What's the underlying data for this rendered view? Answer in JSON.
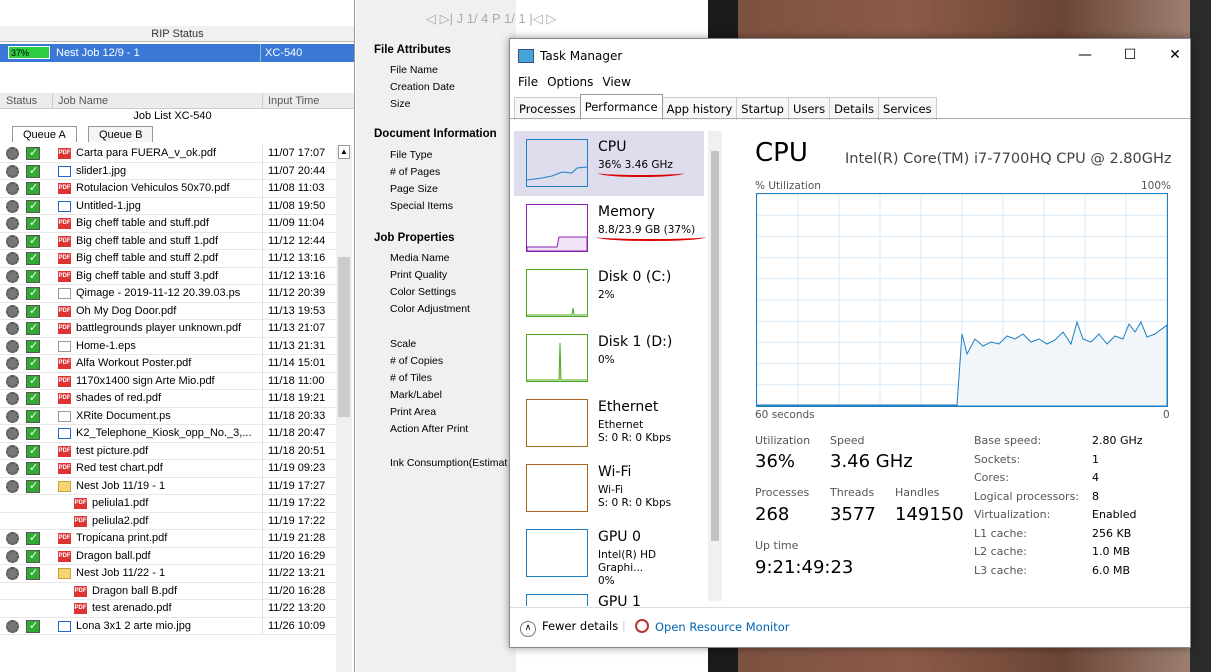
{
  "rip": {
    "title": "RIP Status",
    "progress": "37%",
    "job": "Nest Job 12/9 - 1",
    "printer": "XC-540"
  },
  "joblist": {
    "col_status": "Status",
    "col_job": "Job Name",
    "col_time": "Input Time",
    "title": "Job List XC-540",
    "tab_a": "Queue A",
    "tab_b": "Queue B",
    "rows": [
      {
        "name": "Carta para FUERA_v_ok.pdf",
        "time": "11/07 17:07",
        "type": "pdf"
      },
      {
        "name": "slider1.jpg",
        "time": "11/07 20:44",
        "type": "jpg"
      },
      {
        "name": "Rotulacion Vehiculos 50x70.pdf",
        "time": "11/08 11:03",
        "type": "pdf"
      },
      {
        "name": "Untitled-1.jpg",
        "time": "11/08 19:50",
        "type": "jpg"
      },
      {
        "name": "Big cheff table and stuff.pdf",
        "time": "11/09 11:04",
        "type": "pdf"
      },
      {
        "name": "Big cheff table and stuff 1.pdf",
        "time": "11/12 12:44",
        "type": "pdf"
      },
      {
        "name": "Big cheff table and stuff 2.pdf",
        "time": "11/12 13:16",
        "type": "pdf"
      },
      {
        "name": "Big cheff table and stuff 3.pdf",
        "time": "11/12 13:16",
        "type": "pdf"
      },
      {
        "name": "Qimage - 2019-11-12 20.39.03.ps",
        "time": "11/12 20:39",
        "type": "ps"
      },
      {
        "name": "Oh My Dog Door.pdf",
        "time": "11/13 19:53",
        "type": "pdf"
      },
      {
        "name": "battlegrounds player unknown.pdf",
        "time": "11/13 21:07",
        "type": "pdf"
      },
      {
        "name": "Home-1.eps",
        "time": "11/13 21:31",
        "type": "ps"
      },
      {
        "name": "Alfa Workout  Poster.pdf",
        "time": "11/14 15:01",
        "type": "pdf"
      },
      {
        "name": "1170x1400 sign Arte Mio.pdf",
        "time": "11/18 11:00",
        "type": "pdf"
      },
      {
        "name": "shades of red.pdf",
        "time": "11/18 19:21",
        "type": "pdf"
      },
      {
        "name": "XRite Document.ps",
        "time": "11/18 20:33",
        "type": "ps"
      },
      {
        "name": "K2_Telephone_Kiosk_opp_No._3,...",
        "time": "11/18 20:47",
        "type": "jpg"
      },
      {
        "name": "test picture.pdf",
        "time": "11/18 20:51",
        "type": "pdf"
      },
      {
        "name": "Red test chart.pdf",
        "time": "11/19 09:23",
        "type": "pdf"
      },
      {
        "name": "Nest Job 11/19 - 1",
        "time": "11/19 17:27",
        "type": "fold"
      },
      {
        "name": "peliula1.pdf",
        "time": "11/19 17:22",
        "type": "pdf",
        "child": true
      },
      {
        "name": "peliula2.pdf",
        "time": "11/19 17:22",
        "type": "pdf",
        "child": true
      },
      {
        "name": "Tropicana print.pdf",
        "time": "11/19 21:28",
        "type": "pdf"
      },
      {
        "name": "Dragon ball.pdf",
        "time": "11/20 16:29",
        "type": "pdf"
      },
      {
        "name": "Nest Job 11/22 - 1",
        "time": "11/22 13:21",
        "type": "fold"
      },
      {
        "name": "Dragon ball B.pdf",
        "time": "11/20 16:28",
        "type": "pdf",
        "child": true
      },
      {
        "name": "test arenado.pdf",
        "time": "11/22 13:20",
        "type": "pdf",
        "child": true
      },
      {
        "name": "Lona 3x1 2  arte mio.jpg",
        "time": "11/26 10:09",
        "type": "jpg"
      }
    ]
  },
  "props": {
    "topstrip": "◁ ▷| J  1/   4 P   1/    1 |◁ ▷",
    "file_attr": "File Attributes",
    "file_name": "File Name",
    "creation_date": "Creation Date",
    "size": "Size",
    "doc_info": "Document Information",
    "file_type": "File Type",
    "pages": "# of Pages",
    "page_size": "Page Size",
    "special": "Special Items",
    "job_props": "Job Properties",
    "media": "Media Name",
    "quality": "Print Quality",
    "color_settings": "Color Settings",
    "color_adj": "Color Adjustment",
    "scale": "Scale",
    "copies": "# of Copies",
    "tiles": "# of Tiles",
    "mark": "Mark/Label",
    "print_area": "Print Area",
    "after": "Action After Print",
    "ink": "Ink Consumption(Estimat"
  },
  "tm": {
    "title": "Task Manager",
    "minimize": "—",
    "maximize": "☐",
    "close": "✕",
    "menu": [
      "File",
      "Options",
      "View"
    ],
    "tabs": [
      "Processes",
      "Performance",
      "App history",
      "Startup",
      "Users",
      "Details",
      "Services"
    ],
    "side": [
      {
        "name": "CPU",
        "v1": "36% 3.46 GHz",
        "v2": "",
        "color": "#1f7fc0"
      },
      {
        "name": "Memory",
        "v1": "8.8/23.9 GB (37%)",
        "v2": "",
        "color": "#8b23b0"
      },
      {
        "name": "Disk 0 (C:)",
        "v1": "2%",
        "v2": "",
        "color": "#4ca81f"
      },
      {
        "name": "Disk 1 (D:)",
        "v1": "0%",
        "v2": "",
        "color": "#4ca81f"
      },
      {
        "name": "Ethernet",
        "v1": "Ethernet",
        "v2": "S: 0 R: 0 Kbps",
        "color": "#a8651f"
      },
      {
        "name": "Wi-Fi",
        "v1": "Wi-Fi",
        "v2": "S: 0 R: 0 Kbps",
        "color": "#a8651f"
      },
      {
        "name": "GPU 0",
        "v1": "Intel(R) HD Graphi...",
        "v2": "0%",
        "color": "#1f7fc0"
      },
      {
        "name": "GPU 1",
        "v1": "",
        "v2": "",
        "color": "#1f7fc0"
      }
    ],
    "cpu_title": "CPU",
    "cpu_name": "Intel(R) Core(TM) i7-7700HQ CPU @ 2.80GHz",
    "util_label": "% Utilization",
    "util_max": "100%",
    "seconds": "60 seconds",
    "zero": "0",
    "stats": {
      "util_l": "Utilization",
      "util_v": "36%",
      "speed_l": "Speed",
      "speed_v": "3.46 GHz",
      "proc_l": "Processes",
      "proc_v": "268",
      "threads_l": "Threads",
      "threads_v": "3577",
      "handles_l": "Handles",
      "handles_v": "149150",
      "uptime_l": "Up time",
      "uptime_v": "9:21:49:23"
    },
    "details": [
      {
        "k": "Base speed:",
        "v": "2.80 GHz"
      },
      {
        "k": "Sockets:",
        "v": "1"
      },
      {
        "k": "Cores:",
        "v": "4"
      },
      {
        "k": "Logical processors:",
        "v": "8"
      },
      {
        "k": "Virtualization:",
        "v": "Enabled"
      },
      {
        "k": "L1 cache:",
        "v": "256 KB"
      },
      {
        "k": "L2 cache:",
        "v": "1.0 MB"
      },
      {
        "k": "L3 cache:",
        "v": "6.0 MB"
      }
    ],
    "fewer": "Fewer details",
    "open_res": "Open Resource Monitor"
  }
}
